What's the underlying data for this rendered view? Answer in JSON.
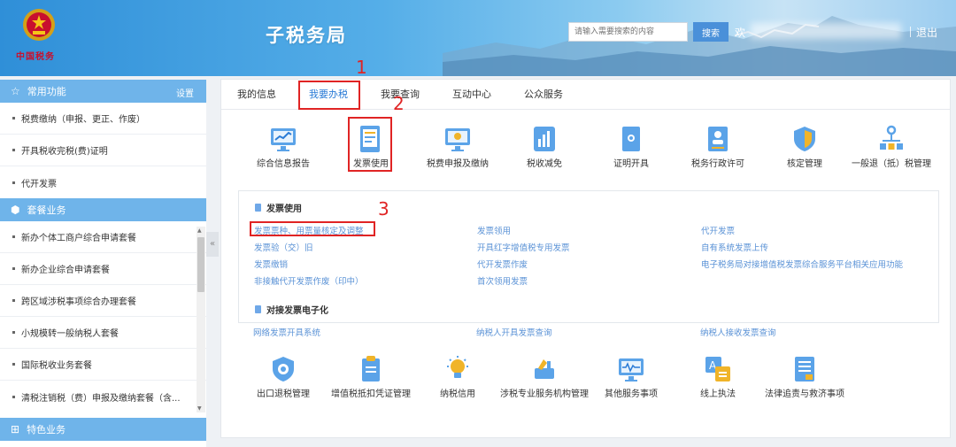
{
  "header": {
    "logo_text": "中国税务",
    "site_title": "子税务局",
    "search_placeholder": "请输入需要搜索的内容",
    "search_label": "搜索",
    "welcome": "欢",
    "logout": "退出"
  },
  "sidebar": {
    "sections": [
      {
        "title": "常用功能",
        "action": "设置",
        "items": [
          "税费缴纳（申报、更正、作废）",
          "开具税收完税(费)证明",
          "代开发票"
        ]
      },
      {
        "title": "套餐业务",
        "items": [
          "新办个体工商户综合申请套餐",
          "新办企业综合申请套餐",
          "跨区域涉税事项综合办理套餐",
          "小规模转一般纳税人套餐",
          "国际税收业务套餐",
          "清税注销税（费）申报及缴纳套餐（含..."
        ]
      },
      {
        "title": "特色业务",
        "items": []
      }
    ]
  },
  "main": {
    "tabs": [
      "我的信息",
      "我要办税",
      "我要查询",
      "互动中心",
      "公众服务"
    ],
    "active_tab": "我要办税",
    "row1": [
      "综合信息报告",
      "发票使用",
      "税费申报及缴纳",
      "税收减免",
      "证明开具",
      "税务行政许可",
      "核定管理",
      "一般退（抵）税管理"
    ],
    "submenu": {
      "sections": [
        {
          "title": "发票使用",
          "links": [
            [
              "发票票种、用票量核定及调整",
              "发票领用",
              "代开发票"
            ],
            [
              "发票验（交）旧",
              "开具红字增值税专用发票",
              "自有系统发票上传"
            ],
            [
              "发票缴销",
              "代开发票作废",
              "电子税务局对接增值税发票综合服务平台相关应用功能"
            ],
            [
              "非接触代开发票作废（印中）",
              "首次领用发票"
            ]
          ]
        },
        {
          "title": "对接发票电子化",
          "links": [
            [
              "网络发票开具系统",
              "纳税人开具发票查询",
              "纳税人接收发票查询"
            ]
          ]
        }
      ]
    },
    "row2": [
      "出口退税管理",
      "增值税抵扣凭证管理",
      "纳税信用",
      "涉税专业服务机构管理",
      "其他服务事项",
      "线上执法",
      "法律追责与救济事项"
    ]
  },
  "annotations": [
    "1",
    "2",
    "3"
  ],
  "colors": {
    "accent": "#2a7bd6",
    "sidebar_header": "#6fb4ea",
    "link": "#5a92d6",
    "annotation": "#e02424"
  }
}
